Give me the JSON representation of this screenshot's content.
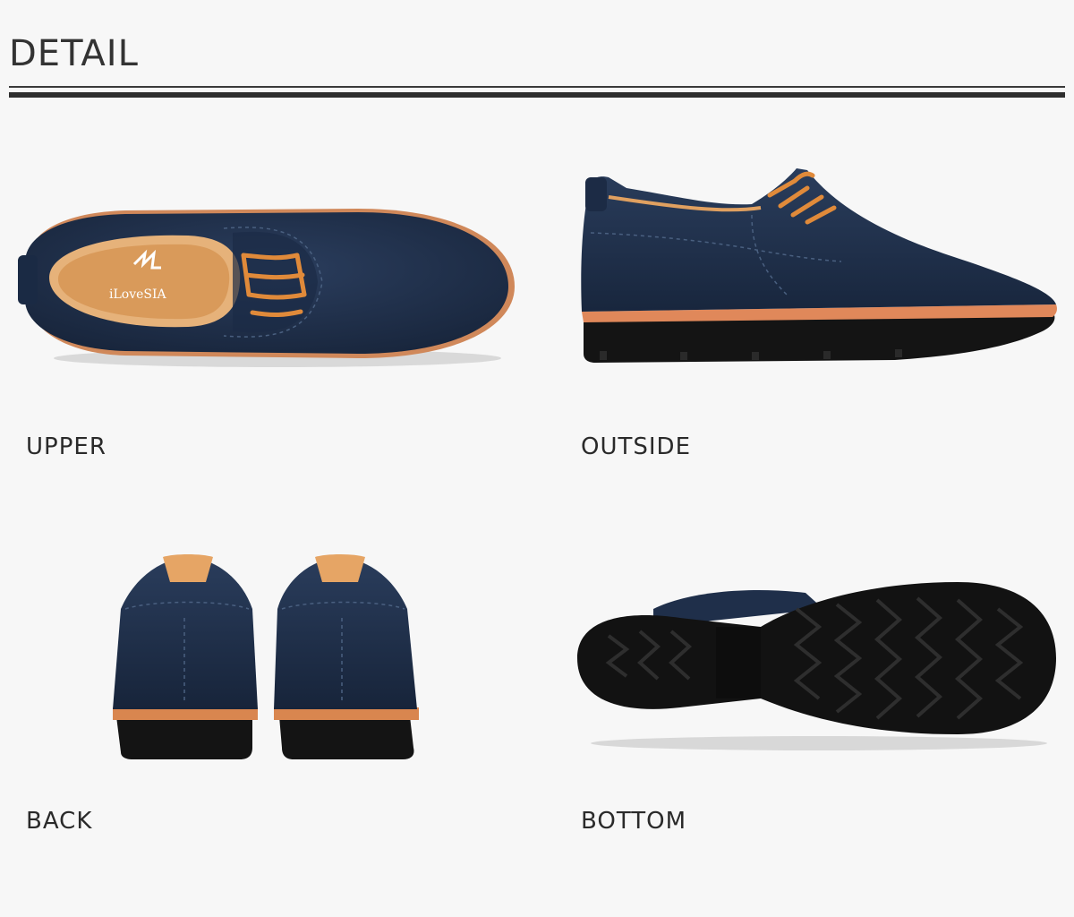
{
  "header": {
    "title": "DETAIL"
  },
  "views": [
    {
      "label": "UPPER"
    },
    {
      "label": "OUTSIDE"
    },
    {
      "label": "BACK"
    },
    {
      "label": "BOTTOM"
    }
  ],
  "brand": {
    "insole_logo": "iLoveSIA"
  },
  "colors": {
    "suede": "#1f2f4a",
    "lace": "#e08a3a",
    "sole": "#141414",
    "welt": "#e0885a",
    "background": "#f7f7f7"
  }
}
